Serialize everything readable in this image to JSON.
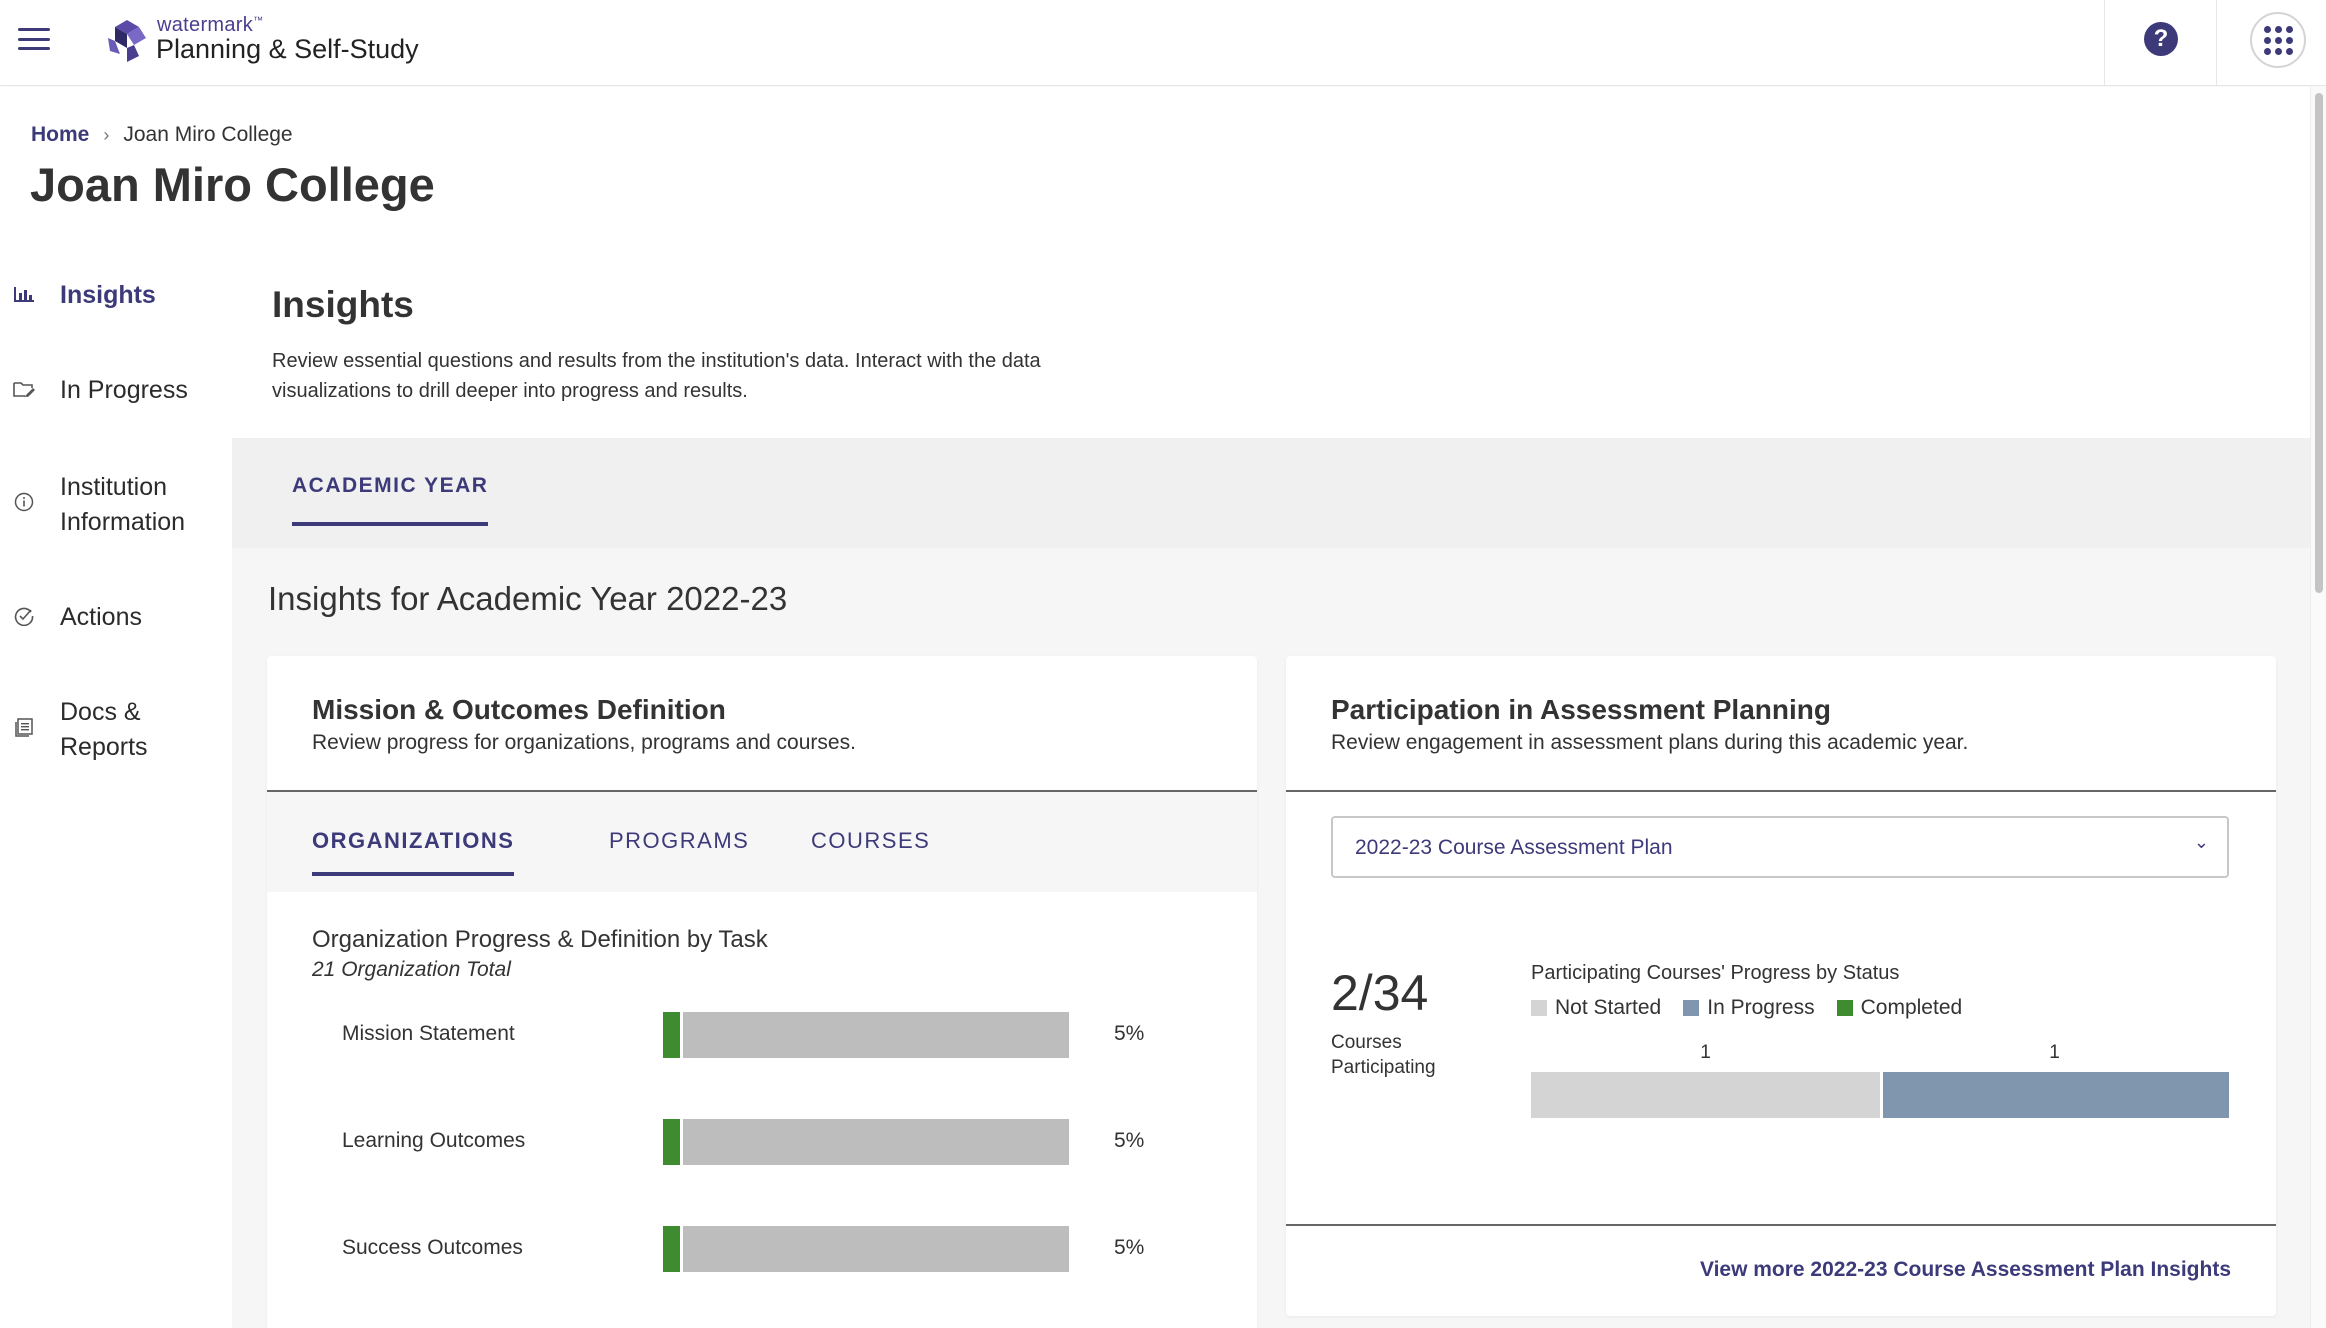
{
  "app": {
    "brand_small": "watermark",
    "brand_tm": "™",
    "brand_name": "Planning & Self-Study"
  },
  "breadcrumb": {
    "home": "Home",
    "separator": "›",
    "current": "Joan Miro College"
  },
  "page_title": "Joan Miro College",
  "sidebar": {
    "items": [
      {
        "label": "Insights",
        "icon": "bar-chart-icon",
        "active": true
      },
      {
        "label": "In Progress",
        "icon": "folder-edit-icon"
      },
      {
        "label": "Institution Information",
        "icon": "info-icon"
      },
      {
        "label": "Actions",
        "icon": "check-circle-icon"
      },
      {
        "label": "Docs & Reports",
        "icon": "document-list-icon"
      }
    ]
  },
  "insights": {
    "title": "Insights",
    "description": "Review essential questions and results from the institution's data. Interact with the data visualizations to drill deeper into progress and results.",
    "tab": "ACADEMIC YEAR",
    "section_title": "Insights for Academic Year 2022-23"
  },
  "mission_card": {
    "title": "Mission & Outcomes Definition",
    "subtitle": "Review progress for organizations, programs and courses.",
    "tabs": [
      "ORGANIZATIONS",
      "PROGRAMS",
      "COURSES"
    ],
    "chart_title": "Organization Progress & Definition by Task",
    "chart_subtitle": "21 Organization Total"
  },
  "participation_card": {
    "title": "Participation in Assessment Planning",
    "subtitle": "Review engagement in assessment plans during this academic year.",
    "select_value": "2022-23 Course Assessment Plan",
    "count": "2/34",
    "count_label_1": "Courses",
    "count_label_2": "Participating",
    "status_title": "Participating Courses' Progress by Status",
    "view_more": "View more 2022-23 Course Assessment Plan Insights"
  },
  "colors": {
    "accent": "#3d3a7a",
    "completed": "#3f8b2f",
    "remaining": "#bdbdbd",
    "not_started": "#d4d4d4",
    "in_progress": "#7f96ae"
  },
  "chart_data": [
    {
      "type": "bar",
      "title": "Organization Progress & Definition by Task",
      "subtitle": "21 Organization Total",
      "categories": [
        "Mission Statement",
        "Learning Outcomes",
        "Success Outcomes"
      ],
      "values": [
        5,
        5,
        5
      ],
      "value_labels": [
        "5%",
        "5%",
        "5%"
      ],
      "ylim": [
        0,
        100
      ]
    },
    {
      "type": "bar",
      "title": "Participating Courses' Progress by Status",
      "legend": [
        "Not Started",
        "In Progress",
        "Completed"
      ],
      "legend_colors": [
        "#d4d4d4",
        "#7f96ae",
        "#3f8b2f"
      ],
      "series": [
        {
          "name": "Not Started",
          "values": [
            1
          ]
        },
        {
          "name": "In Progress",
          "values": [
            1
          ]
        },
        {
          "name": "Completed",
          "values": [
            0
          ]
        }
      ],
      "stacked": true
    }
  ]
}
